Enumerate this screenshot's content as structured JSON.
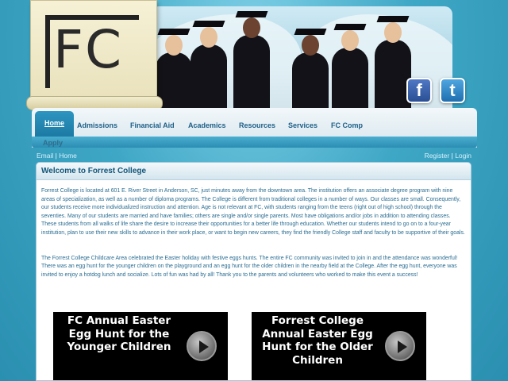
{
  "header": {
    "logo_text": "FC",
    "social": [
      {
        "label": "f",
        "icon": "facebook-icon"
      },
      {
        "label": "t",
        "icon": "twitter-icon"
      }
    ]
  },
  "nav": {
    "items": [
      "Home",
      "Admissions",
      "Financial Aid",
      "Academics",
      "Resources",
      "Services",
      "FC Comp"
    ],
    "apply": "Apply"
  },
  "utility": {
    "left": [
      "Email",
      "Home"
    ],
    "right": [
      "Register",
      "Login"
    ],
    "separator": "|"
  },
  "main": {
    "title": "Welcome to Forrest College",
    "paragraph1": "Forrest College is located at 601 E. River Street in Anderson, SC, just minutes away from the downtown area. The institution offers an associate degree program with nine areas of specialization, as well as a number of diploma programs. The College is different from traditional colleges in a number of ways. Our classes are small. Consequently, our students receive more individualized instruction and attention. Age is not relevant at FC, with students ranging from the teens (right out of high school) through the seventies. Many of our students are married and have families; others are single and/or single parents. Most have obligations and/or jobs in addition to attending classes. These students from all walks of life share the desire to increase their opportunities for a better life through education. Whether our students intend to go on to a four-year institution, plan to use their new skills to advance in their work place, or want to begin new careers, they find the friendly College staff and faculty to be supportive of their goals.",
    "paragraph2": "The Forrest College Childcare Area celebrated the Easter holiday with festive eggs hunts. The entire FC community was invited to join in and the attendance was wonderful! There was an egg hunt for the younger children on the playground and an egg hunt for the older children in the nearby field at the College. After the egg hunt, everyone was invited to enjoy a hotdog lunch and socialize. Lots of fun was had by all! Thank you to the parents and volunteers who worked to make this event a success!",
    "videos": [
      {
        "title": "FC Annual Easter Egg Hunt for the Younger Children"
      },
      {
        "title": "Forrest College Annual Easter Egg Hunt for the Older Children"
      }
    ]
  },
  "colors": {
    "background": "#3aa3c2",
    "nav_active": "#1c7aa4",
    "text": "#2a6d92",
    "title": "#11567a"
  }
}
